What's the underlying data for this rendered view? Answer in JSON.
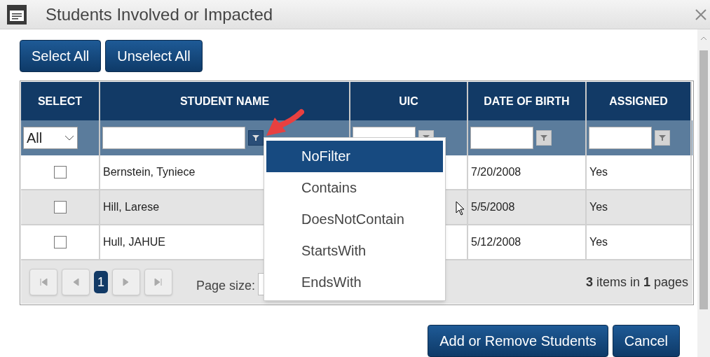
{
  "window": {
    "title": "Students Involved or Impacted"
  },
  "toolbar_buttons": [
    "Select All",
    "Unselect All"
  ],
  "grid": {
    "columns": [
      {
        "label": "SELECT",
        "kind": "dropdown",
        "filter_value": "All"
      },
      {
        "label": "STUDENT NAME",
        "kind": "text",
        "filter_open": true
      },
      {
        "label": "UIC",
        "kind": "text",
        "filter_open": false
      },
      {
        "label": "DATE OF BIRTH",
        "kind": "text",
        "filter_open": false
      },
      {
        "label": "ASSIGNED",
        "kind": "text",
        "filter_open": false
      }
    ],
    "rows": [
      {
        "checked": false,
        "name": "Bernstein, Tyniece",
        "dob": "7/20/2008",
        "assigned": "Yes"
      },
      {
        "checked": false,
        "name": "Hill, Larese",
        "dob": "5/5/2008",
        "assigned": "Yes"
      },
      {
        "checked": false,
        "name": "Hull, JAHUE",
        "dob": "5/12/2008",
        "assigned": "Yes"
      }
    ],
    "pager": {
      "current_page": "1",
      "page_size_label": "Page size:",
      "summary": "**3** items in **1** pages"
    }
  },
  "filter_menu": {
    "items": [
      {
        "label": "NoFilter",
        "selected": true
      },
      {
        "label": "Contains",
        "selected": false
      },
      {
        "label": "DoesNotContain",
        "selected": false
      },
      {
        "label": "StartsWith",
        "selected": false
      },
      {
        "label": "EndsWith",
        "selected": false
      }
    ]
  },
  "footer_buttons": [
    "Add or Remove Students",
    "Cancel"
  ]
}
